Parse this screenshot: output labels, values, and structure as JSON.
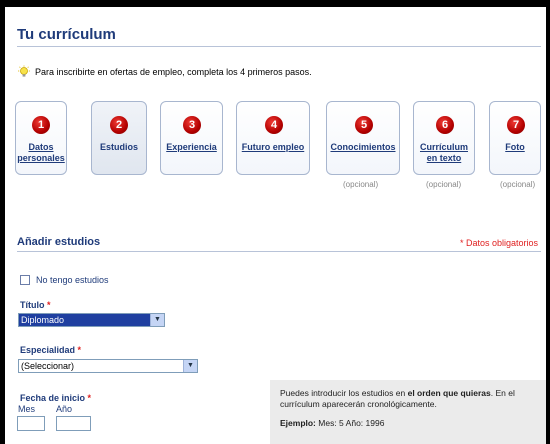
{
  "page": {
    "title": "Tu currículum",
    "hint_text": "Para inscribirte en ofertas de empleo,",
    "hint_rest": "completa los 4 primeros pasos."
  },
  "steps": [
    {
      "number": "1",
      "label_line1": "Datos",
      "label_line2": "personales",
      "optional": ""
    },
    {
      "number": "2",
      "label_line1": "Estudios",
      "label_line2": "",
      "optional": ""
    },
    {
      "number": "3",
      "label_line1": "Experiencia",
      "label_line2": "",
      "optional": ""
    },
    {
      "number": "4",
      "label_line1": "Futuro empleo",
      "label_line2": "",
      "optional": ""
    },
    {
      "number": "5",
      "label_line1": "Conocimientos",
      "label_line2": "",
      "optional": "(opcional)"
    },
    {
      "number": "6",
      "label_line1": "Currículum",
      "label_line2": "en texto",
      "optional": "(opcional)"
    },
    {
      "number": "7",
      "label_line1": "Foto",
      "label_line2": "",
      "optional": "(opcional)"
    }
  ],
  "form": {
    "section_title": "Añadir estudios",
    "required_note": "* Datos obligatorios",
    "no_studies_label": "No tengo estudios",
    "titulo_label": "Título",
    "titulo_value": "Diplomado",
    "especialidad_label": "Especialidad",
    "especialidad_value": "(Seleccionar)",
    "fecha_label": "Fecha de inicio",
    "mes_label": "Mes",
    "ano_label": "Año",
    "required_mark": "*"
  },
  "info": {
    "line1_a": "Puedes introducir los estudios en",
    "line1_b": "el orden que quieras",
    "line1_c": ". En el",
    "line2": "currículum aparecerán cronológicamente.",
    "example_label": "Ejemplo:",
    "example_text": "Mes: 5  Año: 1996"
  },
  "colors": {
    "title": "#1f3b7a",
    "required": "#e02020",
    "badge": "#c80000",
    "selected_select": "#1f3fa0"
  },
  "icons": {
    "hint": "lightbulb-icon",
    "dropdown": "chevron-down-icon"
  }
}
